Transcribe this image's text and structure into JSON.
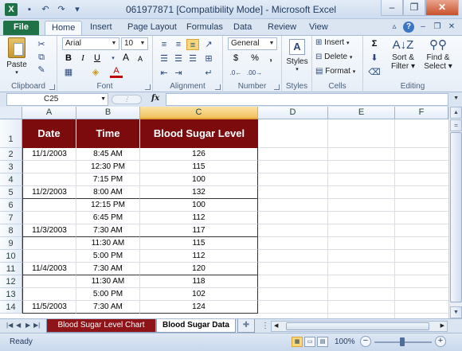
{
  "window": {
    "title": "061977871  [Compatibility Mode]  -  Microsoft Excel",
    "app_icon_letter": "X",
    "controls": [
      "–",
      "❐",
      "✕"
    ]
  },
  "qat": [
    {
      "icon": "save-icon",
      "glyph": "▪"
    },
    {
      "icon": "undo-icon",
      "glyph": "↶"
    },
    {
      "icon": "redo-icon",
      "glyph": "↷"
    },
    {
      "icon": "customize-icon",
      "glyph": "▾"
    }
  ],
  "ribbon_tabs": [
    "File",
    "Home",
    "Insert",
    "Page Layout",
    "Formulas",
    "Data",
    "Review",
    "View"
  ],
  "ribbon": {
    "clipboard": {
      "label": "Clipboard",
      "paste": "Paste"
    },
    "font": {
      "label": "Font",
      "name": "Arial",
      "size": "10",
      "bold": "B",
      "italic": "I",
      "underline": "U",
      "grow": "A",
      "shrink": "A",
      "color": "A"
    },
    "alignment": {
      "label": "Alignment"
    },
    "number": {
      "label": "Number",
      "format": "General",
      "currency": "$",
      "percent": "%",
      "comma": ","
    },
    "styles": {
      "label": "Styles",
      "button": "Styles"
    },
    "cells": {
      "label": "Cells",
      "insert": "Insert",
      "delete": "Delete",
      "format": "Format"
    },
    "editing": {
      "label": "Editing",
      "sigma": "Σ",
      "sort": "Sort &",
      "filter": "Filter",
      "find": "Find &",
      "select": "Select"
    }
  },
  "formula_bar": {
    "name_box": "C25",
    "fx": "fx",
    "formula": ""
  },
  "columns": [
    "A",
    "B",
    "C",
    "D",
    "E",
    "F"
  ],
  "selected_column": "C",
  "table_header": {
    "date": "Date",
    "time": "Time",
    "level": "Blood Sugar Level"
  },
  "rows": [
    {
      "n": "1"
    },
    {
      "n": "2",
      "date": "11/1/2003",
      "time": "8:45 AM",
      "level": "126"
    },
    {
      "n": "3",
      "date": "",
      "time": "12:30 PM",
      "level": "115"
    },
    {
      "n": "4",
      "date": "",
      "time": "7:15 PM",
      "level": "100"
    },
    {
      "n": "5",
      "date": "11/2/2003",
      "time": "8:00 AM",
      "level": "132"
    },
    {
      "n": "6",
      "date": "",
      "time": "12:15 PM",
      "level": "100"
    },
    {
      "n": "7",
      "date": "",
      "time": "6:45 PM",
      "level": "112"
    },
    {
      "n": "8",
      "date": "11/3/2003",
      "time": "7:30 AM",
      "level": "117"
    },
    {
      "n": "9",
      "date": "",
      "time": "11:30 AM",
      "level": "115"
    },
    {
      "n": "10",
      "date": "",
      "time": "5:00 PM",
      "level": "112"
    },
    {
      "n": "11",
      "date": "11/4/2003",
      "time": "7:30 AM",
      "level": "120"
    },
    {
      "n": "12",
      "date": "",
      "time": "11:30 AM",
      "level": "118"
    },
    {
      "n": "13",
      "date": "",
      "time": "5:00 PM",
      "level": "102"
    },
    {
      "n": "14",
      "date": "11/5/2003",
      "time": "7:30 AM",
      "level": "124"
    }
  ],
  "sheet_tabs": {
    "chart": "Blood Sugar Level Chart",
    "data": "Blood Sugar Data"
  },
  "status": {
    "ready": "Ready",
    "zoom": "100%"
  },
  "colors": {
    "header_fill": "#7b0b0d",
    "selected_col": "#f1c15f",
    "file_tab": "#1f7246"
  }
}
